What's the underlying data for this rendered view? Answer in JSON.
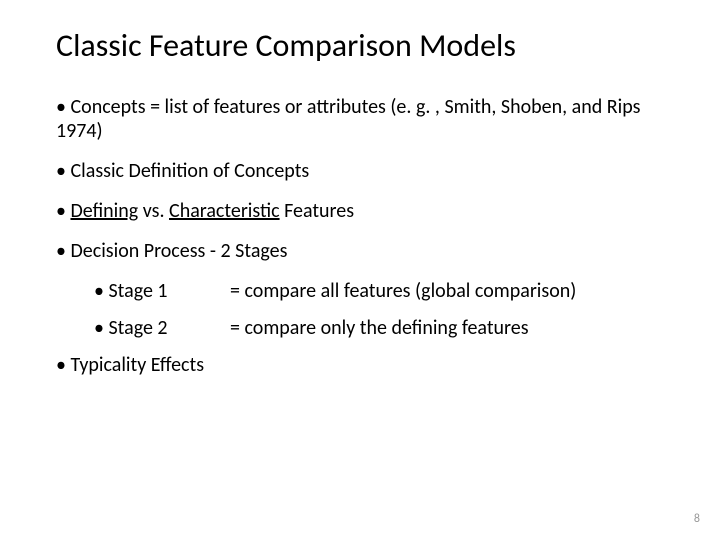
{
  "title": "Classic Feature Comparison Models",
  "bullets": {
    "b1": "• Concepts = list of features or attributes  (e. g. , Smith, Shoben, and Rips 1974)",
    "b2": "• Classic Definition of Concepts",
    "b3_pre": "• ",
    "b3_def": "Defining",
    "b3_vs": " vs. ",
    "b3_char": "Characteristic",
    "b3_post": " Features",
    "b4": "• Decision Process - 2 Stages",
    "s1_label": "• Stage 1",
    "s1_desc": "= compare all features (global comparison)",
    "s2_label": "• Stage 2",
    "s2_desc": "= compare only the defining features",
    "b5": "• Typicality Effects"
  },
  "page_number": "8"
}
